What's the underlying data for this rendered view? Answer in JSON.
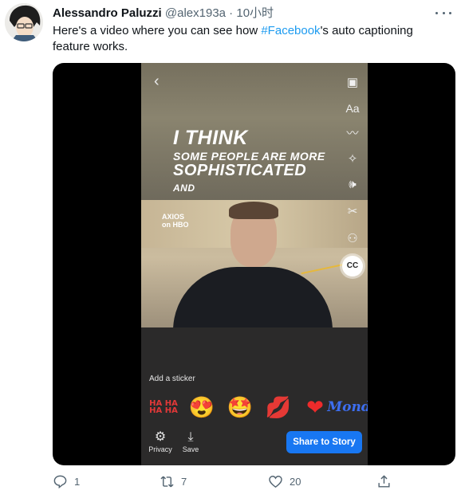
{
  "tweet": {
    "author_name": "Alessandro Paluzzi",
    "author_handle": "@alex193a",
    "separator": " · ",
    "time": "10小时",
    "text_before": "Here's a video where you can see how ",
    "hashtag": "#Facebook",
    "text_after": "'s auto captioning feature works."
  },
  "video": {
    "captions": [
      "I THINK",
      "SOME PEOPLE ARE MORE",
      "SOPHISTICATED",
      "AND"
    ],
    "logo_top": "AXIOS",
    "logo_bottom": "on HBO",
    "sidebar_icons": [
      "sticker-icon",
      "text-icon",
      "draw-icon",
      "effects-icon",
      "volume-icon",
      "cut-icon",
      "tag-person-icon",
      "captions-icon"
    ],
    "cc_label": "CC",
    "sticker_label": "Add a sticker",
    "sticker_haha": "HA HA\nHA HA",
    "sticker_mondo": "Monda",
    "privacy_label": "Privacy",
    "save_label": "Save",
    "share_label": "Share to Story"
  },
  "actions": {
    "replies": "1",
    "retweets": "7",
    "likes": "20"
  },
  "colors": {
    "link": "#1d9bf0",
    "share_button": "#1877f2",
    "muted": "#536471"
  }
}
